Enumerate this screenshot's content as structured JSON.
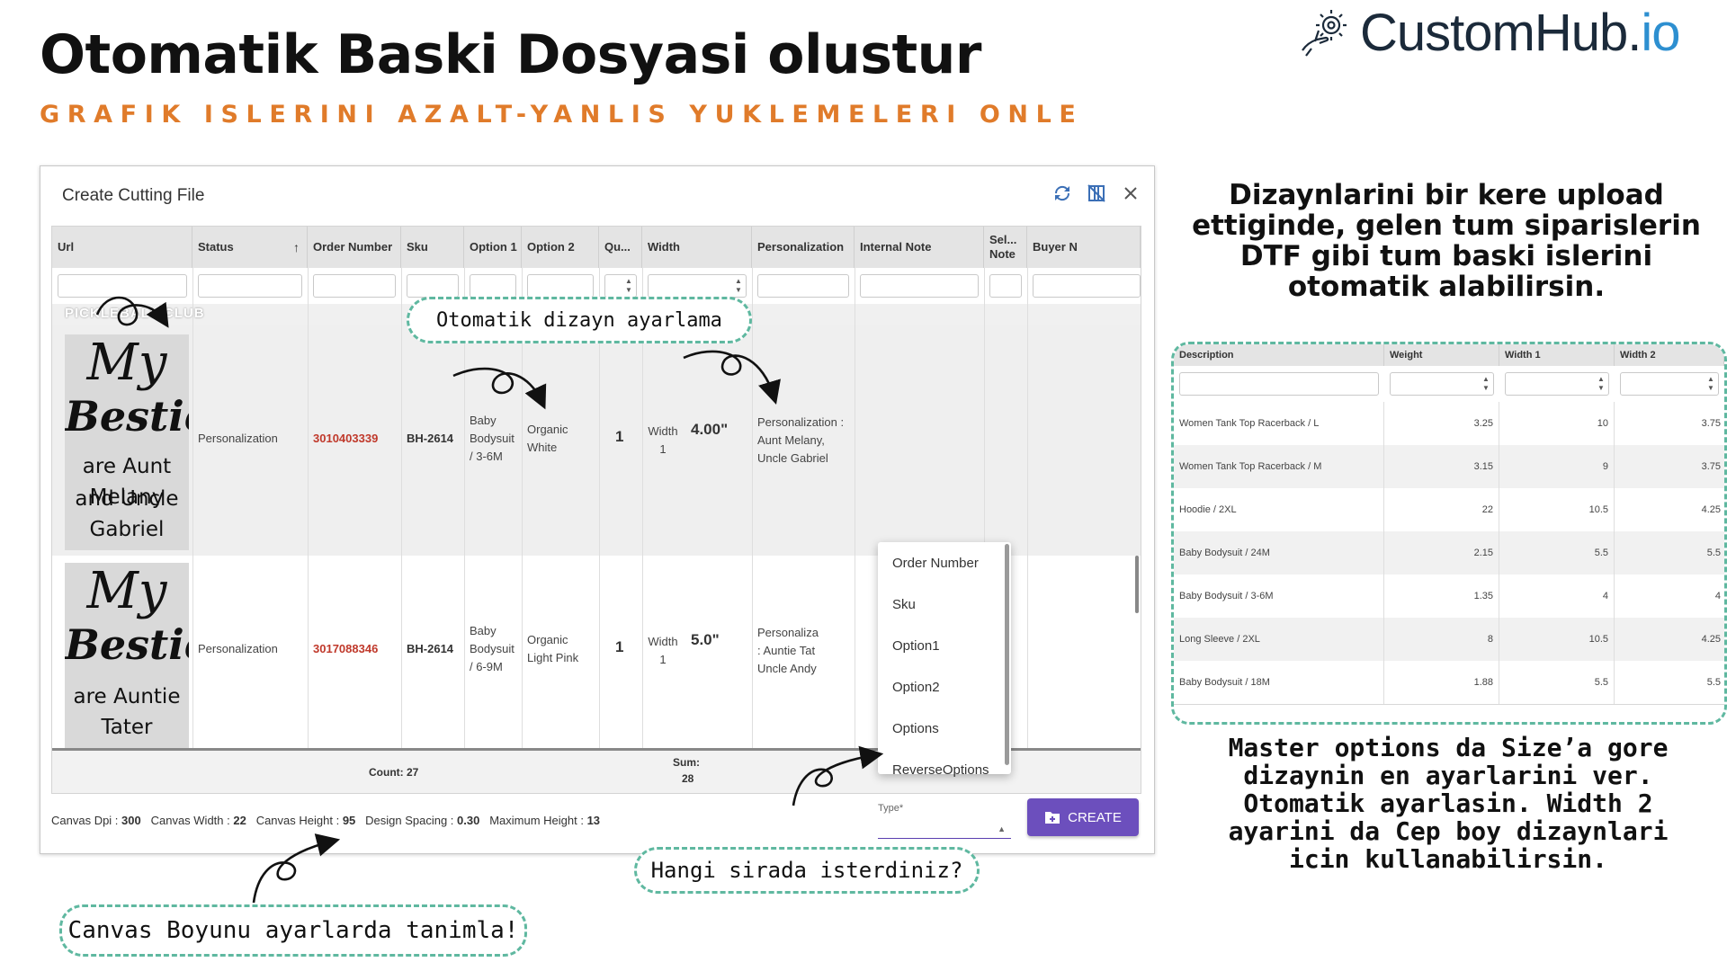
{
  "header": {
    "title": "Otomatik Baski Dosyasi olustur",
    "subtitle": "GRAFIK ISLERINI AZALT-YANLIS YUKLEMELERI ONLE",
    "logo": {
      "text_main": "CustomHub.",
      "text_accent": "io",
      "icon": "gear-hand-icon"
    }
  },
  "dialog": {
    "title": "Create Cutting File",
    "icons": [
      "refresh-icon",
      "columns-icon",
      "close-icon"
    ],
    "columns": [
      "Url",
      "Status",
      "Order Number",
      "Sku",
      "Option 1",
      "Option 2",
      "Qu...",
      "Width",
      "Personalization",
      "Internal Note",
      "Sel... Note",
      "Buyer N"
    ],
    "rows": [
      {
        "design_top": "PICKLEBALL CLUB",
        "design_lines": [
          "My",
          "Besties",
          "are Aunt Melany",
          "and Uncle Gabriel"
        ],
        "status": "Personalization",
        "order_number": "3010403339",
        "sku": "BH-2614",
        "option1": "Baby Bodysuit / 3-6M",
        "option2": "Organic White",
        "quantity": "1",
        "width_label": "Width 1",
        "width_value": "4.00\"",
        "personalization": "Personalization : Aunt Melany, Uncle Gabriel"
      },
      {
        "design_lines": [
          "My",
          "Besties",
          "are Auntie Tater"
        ],
        "status": "Personalization",
        "order_number": "3017088346",
        "sku": "BH-2614",
        "option1": "Baby Bodysuit / 6-9M",
        "option2": "Organic Light Pink",
        "quantity": "1",
        "width_label": "Width 1",
        "width_value": "5.0\"",
        "personalization": "Personaliza : Auntie Tat Uncle Andy"
      }
    ],
    "footer": {
      "count": "Count: 27",
      "sum_label": "Sum:",
      "sum_value": "28"
    },
    "canvas_info": {
      "dpi_label": "Canvas Dpi :",
      "dpi": "300",
      "width_label": "Canvas Width :",
      "width": "22",
      "height_label": "Canvas Height :",
      "height": "95",
      "spacing_label": "Design Spacing :",
      "spacing": "0.30",
      "max_label": "Maximum Height :",
      "max": "13"
    },
    "type_field": {
      "label": "Type*"
    },
    "type_menu": [
      "Order Number",
      "Sku",
      "Option1",
      "Option2",
      "Options",
      "ReverseOptions"
    ],
    "create_button": "CREATE"
  },
  "callouts": {
    "auto_design": "Otomatik dizayn ayarlama",
    "order_question": "Hangi sirada isterdiniz?",
    "canvas_height": "Canvas Boyunu ayarlarda tanimla!"
  },
  "side_text_top": "Dizaynlarini bir kere upload ettiginde, gelen tum siparislerin DTF gibi tum baski islerini otomatik alabilirsin.",
  "side_text_bottom": "Master options da Size’a gore dizaynin en ayarlarini ver. Otomatik ayarlasin. Width 2 ayarini da Cep boy dizaynlari icin kullanabilirsin.",
  "master_table": {
    "columns": [
      "Description",
      "Weight",
      "Width 1",
      "Width 2"
    ],
    "rows": [
      {
        "description": "Women Tank Top Racerback / L",
        "weight": "3.25",
        "width1": "10",
        "width2": "3.75"
      },
      {
        "description": "Women Tank Top Racerback / M",
        "weight": "3.15",
        "width1": "9",
        "width2": "3.75"
      },
      {
        "description": "Hoodie / 2XL",
        "weight": "22",
        "width1": "10.5",
        "width2": "4.25"
      },
      {
        "description": "Baby Bodysuit / 24M",
        "weight": "2.15",
        "width1": "5.5",
        "width2": "5.5"
      },
      {
        "description": "Baby Bodysuit / 3-6M",
        "weight": "1.35",
        "width1": "4",
        "width2": "4"
      },
      {
        "description": "Long Sleeve / 2XL",
        "weight": "8",
        "width1": "10.5",
        "width2": "4.25"
      },
      {
        "description": "Baby Bodysuit / 18M",
        "weight": "1.88",
        "width1": "5.5",
        "width2": "5.5"
      }
    ]
  },
  "colors": {
    "accent_orange": "#e07b2a",
    "callout_border": "#5fb8a0",
    "create_button": "#6c4fbd",
    "order_number": "#c0392b"
  }
}
